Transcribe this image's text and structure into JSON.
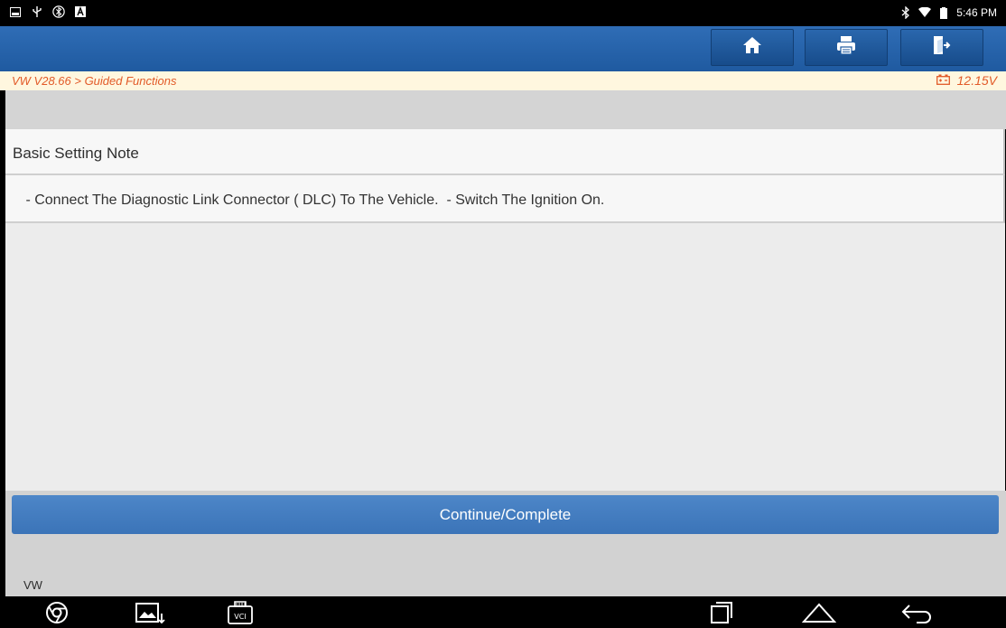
{
  "status_bar": {
    "time": "5:46 PM",
    "left_icons": [
      "image-icon",
      "usb-icon",
      "bluetooth-circle-icon",
      "a-box-icon"
    ],
    "right_icons": [
      "bluetooth-icon",
      "wifi-icon",
      "battery-icon"
    ]
  },
  "toolbar": {
    "buttons": [
      {
        "name": "home-icon"
      },
      {
        "name": "print-icon"
      },
      {
        "name": "exit-icon"
      }
    ]
  },
  "breadcrumb": {
    "path": "VW V28.66 > Guided Functions",
    "voltage": "12.15V",
    "color": "#e25a28"
  },
  "content": {
    "title": "Basic Setting Note",
    "note": " - Connect The Diagnostic Link Connector ( DLC) To The Vehicle.  - Switch The Ignition On."
  },
  "actions": {
    "continue_label": "Continue/Complete",
    "accent_color": "#3b74b8"
  },
  "footer": {
    "brand_label": "VW"
  },
  "nav": {
    "items": [
      "chrome-icon",
      "screenshot-icon",
      "vci-icon",
      "recent-apps-icon",
      "home-nav-icon",
      "back-icon"
    ],
    "vci_text": "VCI"
  }
}
